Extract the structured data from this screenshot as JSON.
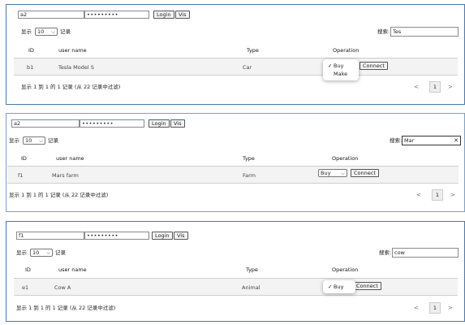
{
  "panels": [
    {
      "id_value": "a2",
      "password_value": "•••••••••",
      "login_label": "Login",
      "vis_label": "Vis",
      "length_prefix": "显示",
      "length_value": "10",
      "length_suffix": "记录",
      "search_label": "搜索:",
      "search_value": "Tes",
      "columns": [
        "ID",
        "user name",
        "Type",
        "Operation"
      ],
      "row": {
        "id": "b1",
        "name": "Tesla Model S",
        "type": "Car",
        "op_value": "",
        "connect_label": "Connect"
      },
      "dropdown": [
        {
          "label": "Buy",
          "checked": true
        },
        {
          "label": "Make",
          "checked": false
        }
      ],
      "info": "显示 1 到 1 的 1 记录 (从 22 记录中过滤)",
      "pager": {
        "prev": "<",
        "page": "1",
        "next": ">"
      }
    },
    {
      "id_value": "a2",
      "password_value": "•••••••••",
      "login_label": "Login",
      "vis_label": "Vis",
      "length_prefix": "显示",
      "length_value": "10",
      "length_suffix": "记录",
      "search_label": "搜索:",
      "search_value": "Mar",
      "clear_icon": "✕",
      "columns": [
        "ID",
        "user name",
        "Type",
        "Operation"
      ],
      "row": {
        "id": "f1",
        "name": "Mars farm",
        "type": "Farm",
        "op_value": "Buy",
        "connect_label": "Connect"
      },
      "info": "显示 1 到 1 的 1 记录 (从 22 记录中过滤)",
      "pager": {
        "prev": "<",
        "page": "1",
        "next": ">"
      }
    },
    {
      "id_value": "f1",
      "password_value": "•••••••••",
      "login_label": "Login",
      "vis_label": "Vis",
      "length_prefix": "显示",
      "length_value": "10",
      "length_suffix": "记录",
      "search_label": "搜索:",
      "search_value": "cow",
      "columns": [
        "ID",
        "user name",
        "Type",
        "Operation"
      ],
      "row": {
        "id": "e1",
        "name": "Cow A",
        "type": "Animal",
        "op_value": "",
        "connect_label": "Connect"
      },
      "dropdown": [
        {
          "label": "Buy",
          "checked": true
        }
      ],
      "info": "显示 1 到 1 的 1 记录 (从 22 记录中过滤)",
      "pager": {
        "prev": "<",
        "page": "1",
        "next": ">"
      }
    }
  ],
  "icons": {
    "chevron": "chevron-down-icon",
    "check": "checkmark-icon",
    "clear": "close-icon"
  },
  "colors": {
    "panel_border": "#4a78b0",
    "row_bg": "#f3f3f3"
  }
}
